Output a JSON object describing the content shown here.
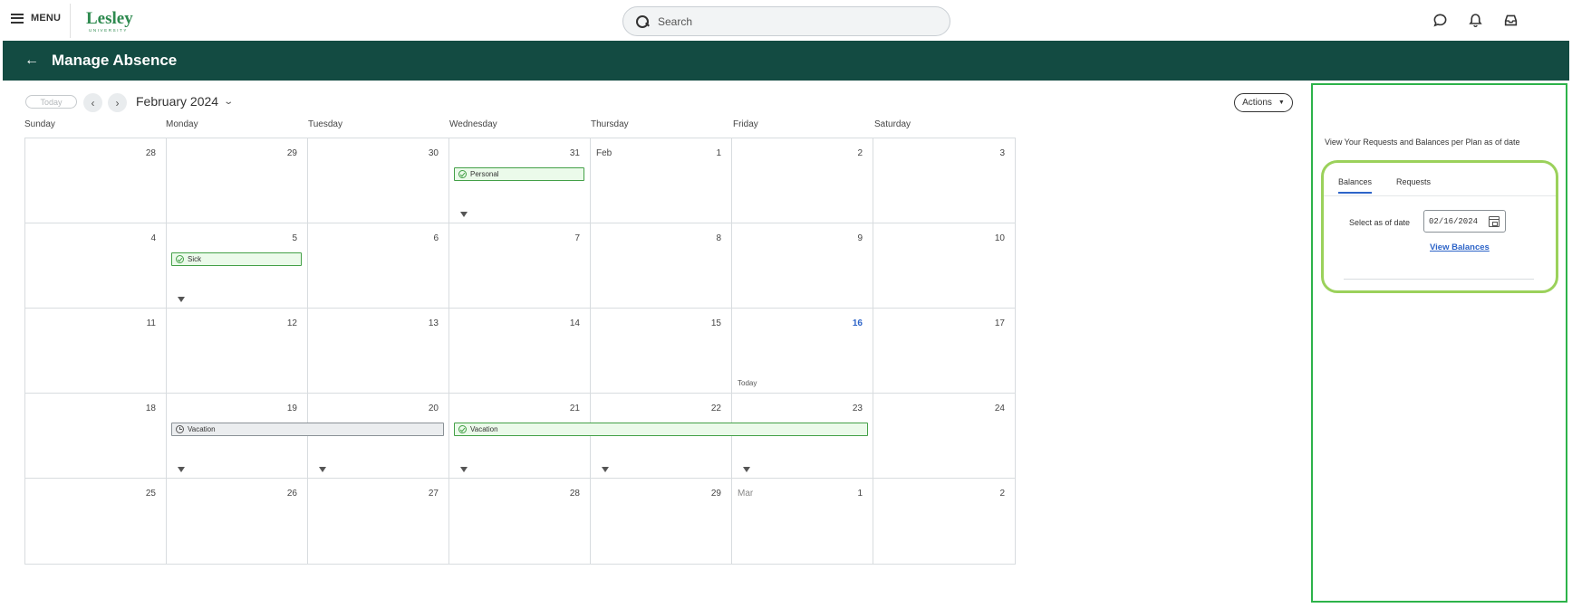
{
  "topbar": {
    "menu_label": "MENU",
    "logo_text": "Lesley",
    "logo_subtext": "UNIVERSITY",
    "search_placeholder": "Search"
  },
  "icons": [
    "hamburger-icon",
    "search-icon",
    "chat-icon",
    "bell-icon",
    "inbox-icon",
    "back-arrow-icon",
    "chevron-left-icon",
    "chevron-right-icon",
    "chevron-down-icon",
    "caret-down-icon",
    "check-circle-icon",
    "clock-icon",
    "calendar-icon"
  ],
  "header": {
    "title": "Manage Absence"
  },
  "calendar": {
    "today_label": "Today",
    "month_label": "February 2024",
    "actions_label": "Actions",
    "weekdays": [
      "Sunday",
      "Monday",
      "Tuesday",
      "Wednesday",
      "Thursday",
      "Friday",
      "Saturday"
    ],
    "weeks": [
      [
        "28",
        "29",
        "30",
        "31",
        "1",
        "2",
        "3"
      ],
      [
        "4",
        "5",
        "6",
        "7",
        "8",
        "9",
        "10"
      ],
      [
        "11",
        "12",
        "13",
        "14",
        "15",
        "16",
        "17"
      ],
      [
        "18",
        "19",
        "20",
        "21",
        "22",
        "23",
        "24"
      ],
      [
        "25",
        "26",
        "27",
        "28",
        "29",
        "1",
        "2"
      ]
    ],
    "month_tags": {
      "feb": "Feb",
      "mar": "Mar"
    },
    "today_cell_label": "Today",
    "events": {
      "personal": "Personal",
      "sick": "Sick",
      "vacation_pending": "Vacation",
      "vacation_approved": "Vacation"
    },
    "colors": {
      "approved_border": "#43a047",
      "approved_fill": "#ebfaea",
      "pending_border": "#8a9196",
      "pending_fill": "#ebedef",
      "today": "#2d64c8",
      "header": "#134b42"
    }
  },
  "side_panel": {
    "heading": "View Your Requests and Balances per Plan as of date",
    "tabs": [
      "Balances",
      "Requests"
    ],
    "active_tab": "Balances",
    "date_label": "Select as of date",
    "date_value": "02/16/2024",
    "view_button": "View Balances"
  }
}
